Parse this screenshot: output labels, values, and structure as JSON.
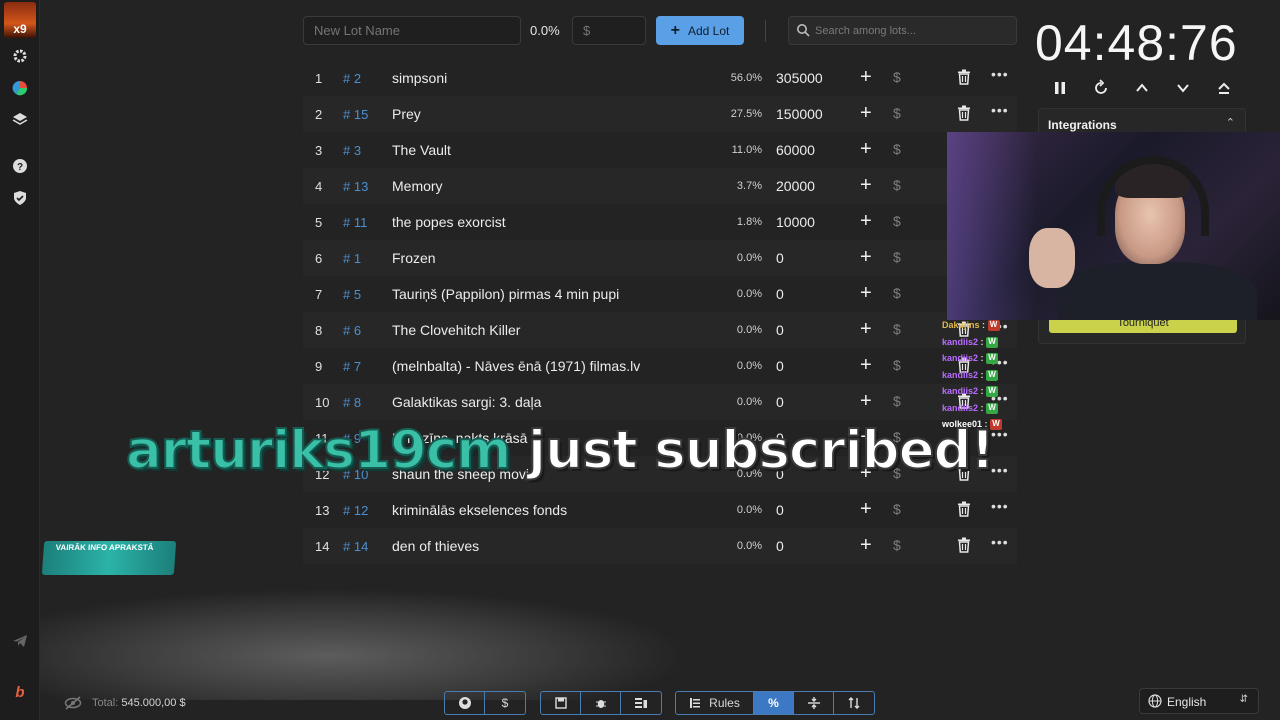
{
  "toolbar": {
    "lot_name_placeholder": "New Lot Name",
    "percent": "0.0%",
    "amount_placeholder": "$",
    "add_lot_label": "Add Lot",
    "search_placeholder": "Search among lots..."
  },
  "timer": "04:48:76",
  "integrations": {
    "title": "Integrations",
    "button": "Tourniquet"
  },
  "lots": [
    {
      "idx": "1",
      "hash": "# 2",
      "name": "simpsoni",
      "pct": "56.0%",
      "amount": "305000"
    },
    {
      "idx": "2",
      "hash": "# 15",
      "name": "Prey",
      "pct": "27.5%",
      "amount": "150000"
    },
    {
      "idx": "3",
      "hash": "# 3",
      "name": "The Vault",
      "pct": "11.0%",
      "amount": "60000"
    },
    {
      "idx": "4",
      "hash": "# 13",
      "name": "Memory",
      "pct": "3.7%",
      "amount": "20000"
    },
    {
      "idx": "5",
      "hash": "# 11",
      "name": "the popes exorcist",
      "pct": "1.8%",
      "amount": "10000"
    },
    {
      "idx": "6",
      "hash": "# 1",
      "name": "Frozen",
      "pct": "0.0%",
      "amount": "0"
    },
    {
      "idx": "7",
      "hash": "# 5",
      "name": "Tauriņš (Pappilon) pirmas 4 min pupi",
      "pct": "0.0%",
      "amount": "0"
    },
    {
      "idx": "8",
      "hash": "# 6",
      "name": "The Clovehitch Killer",
      "pct": "0.0%",
      "amount": "0"
    },
    {
      "idx": "9",
      "hash": "# 7",
      "name": "(melnbalta) - Nāves ēnā (1971) filmas.lv",
      "pct": "0.0%",
      "amount": "0"
    },
    {
      "idx": "10",
      "hash": "# 8",
      "name": "Galaktikas sargi: 3. daļa",
      "pct": "0.0%",
      "amount": "0"
    },
    {
      "idx": "11",
      "hash": "# 9",
      "name": "Limuzīns, nakts krāsā",
      "pct": "0.0%",
      "amount": "0"
    },
    {
      "idx": "12",
      "hash": "# 10",
      "name": "shaun the sheep movie",
      "pct": "0.0%",
      "amount": "0"
    },
    {
      "idx": "13",
      "hash": "# 12",
      "name": "kriminālās ekselences fonds",
      "pct": "0.0%",
      "amount": "0"
    },
    {
      "idx": "14",
      "hash": "# 14",
      "name": "den of thieves",
      "pct": "0.0%",
      "amount": "0"
    }
  ],
  "chat": [
    {
      "user": "Dakujins",
      "color": "gold",
      "emote": "W"
    },
    {
      "user": "kandiis2",
      "color": "purple",
      "emote": "W"
    },
    {
      "user": "kandiis2",
      "color": "purple",
      "emote": "W"
    },
    {
      "user": "kandiis2",
      "color": "purple",
      "emote": "W"
    },
    {
      "user": "kandiis2",
      "color": "purple",
      "emote": "W"
    },
    {
      "user": "kandiis2",
      "color": "purple",
      "emote": "W"
    },
    {
      "user": "wolkee01",
      "color": "white",
      "emote": "W"
    }
  ],
  "overlay": {
    "username": "arturiks19cm",
    "message": "just subscribed!"
  },
  "info_badge": "VAIRĀK INFO APRAKSTĀ",
  "footer": {
    "total_label": "Total:",
    "total_value": "545.000,00 $",
    "rules_label": "Rules",
    "language": "English"
  }
}
